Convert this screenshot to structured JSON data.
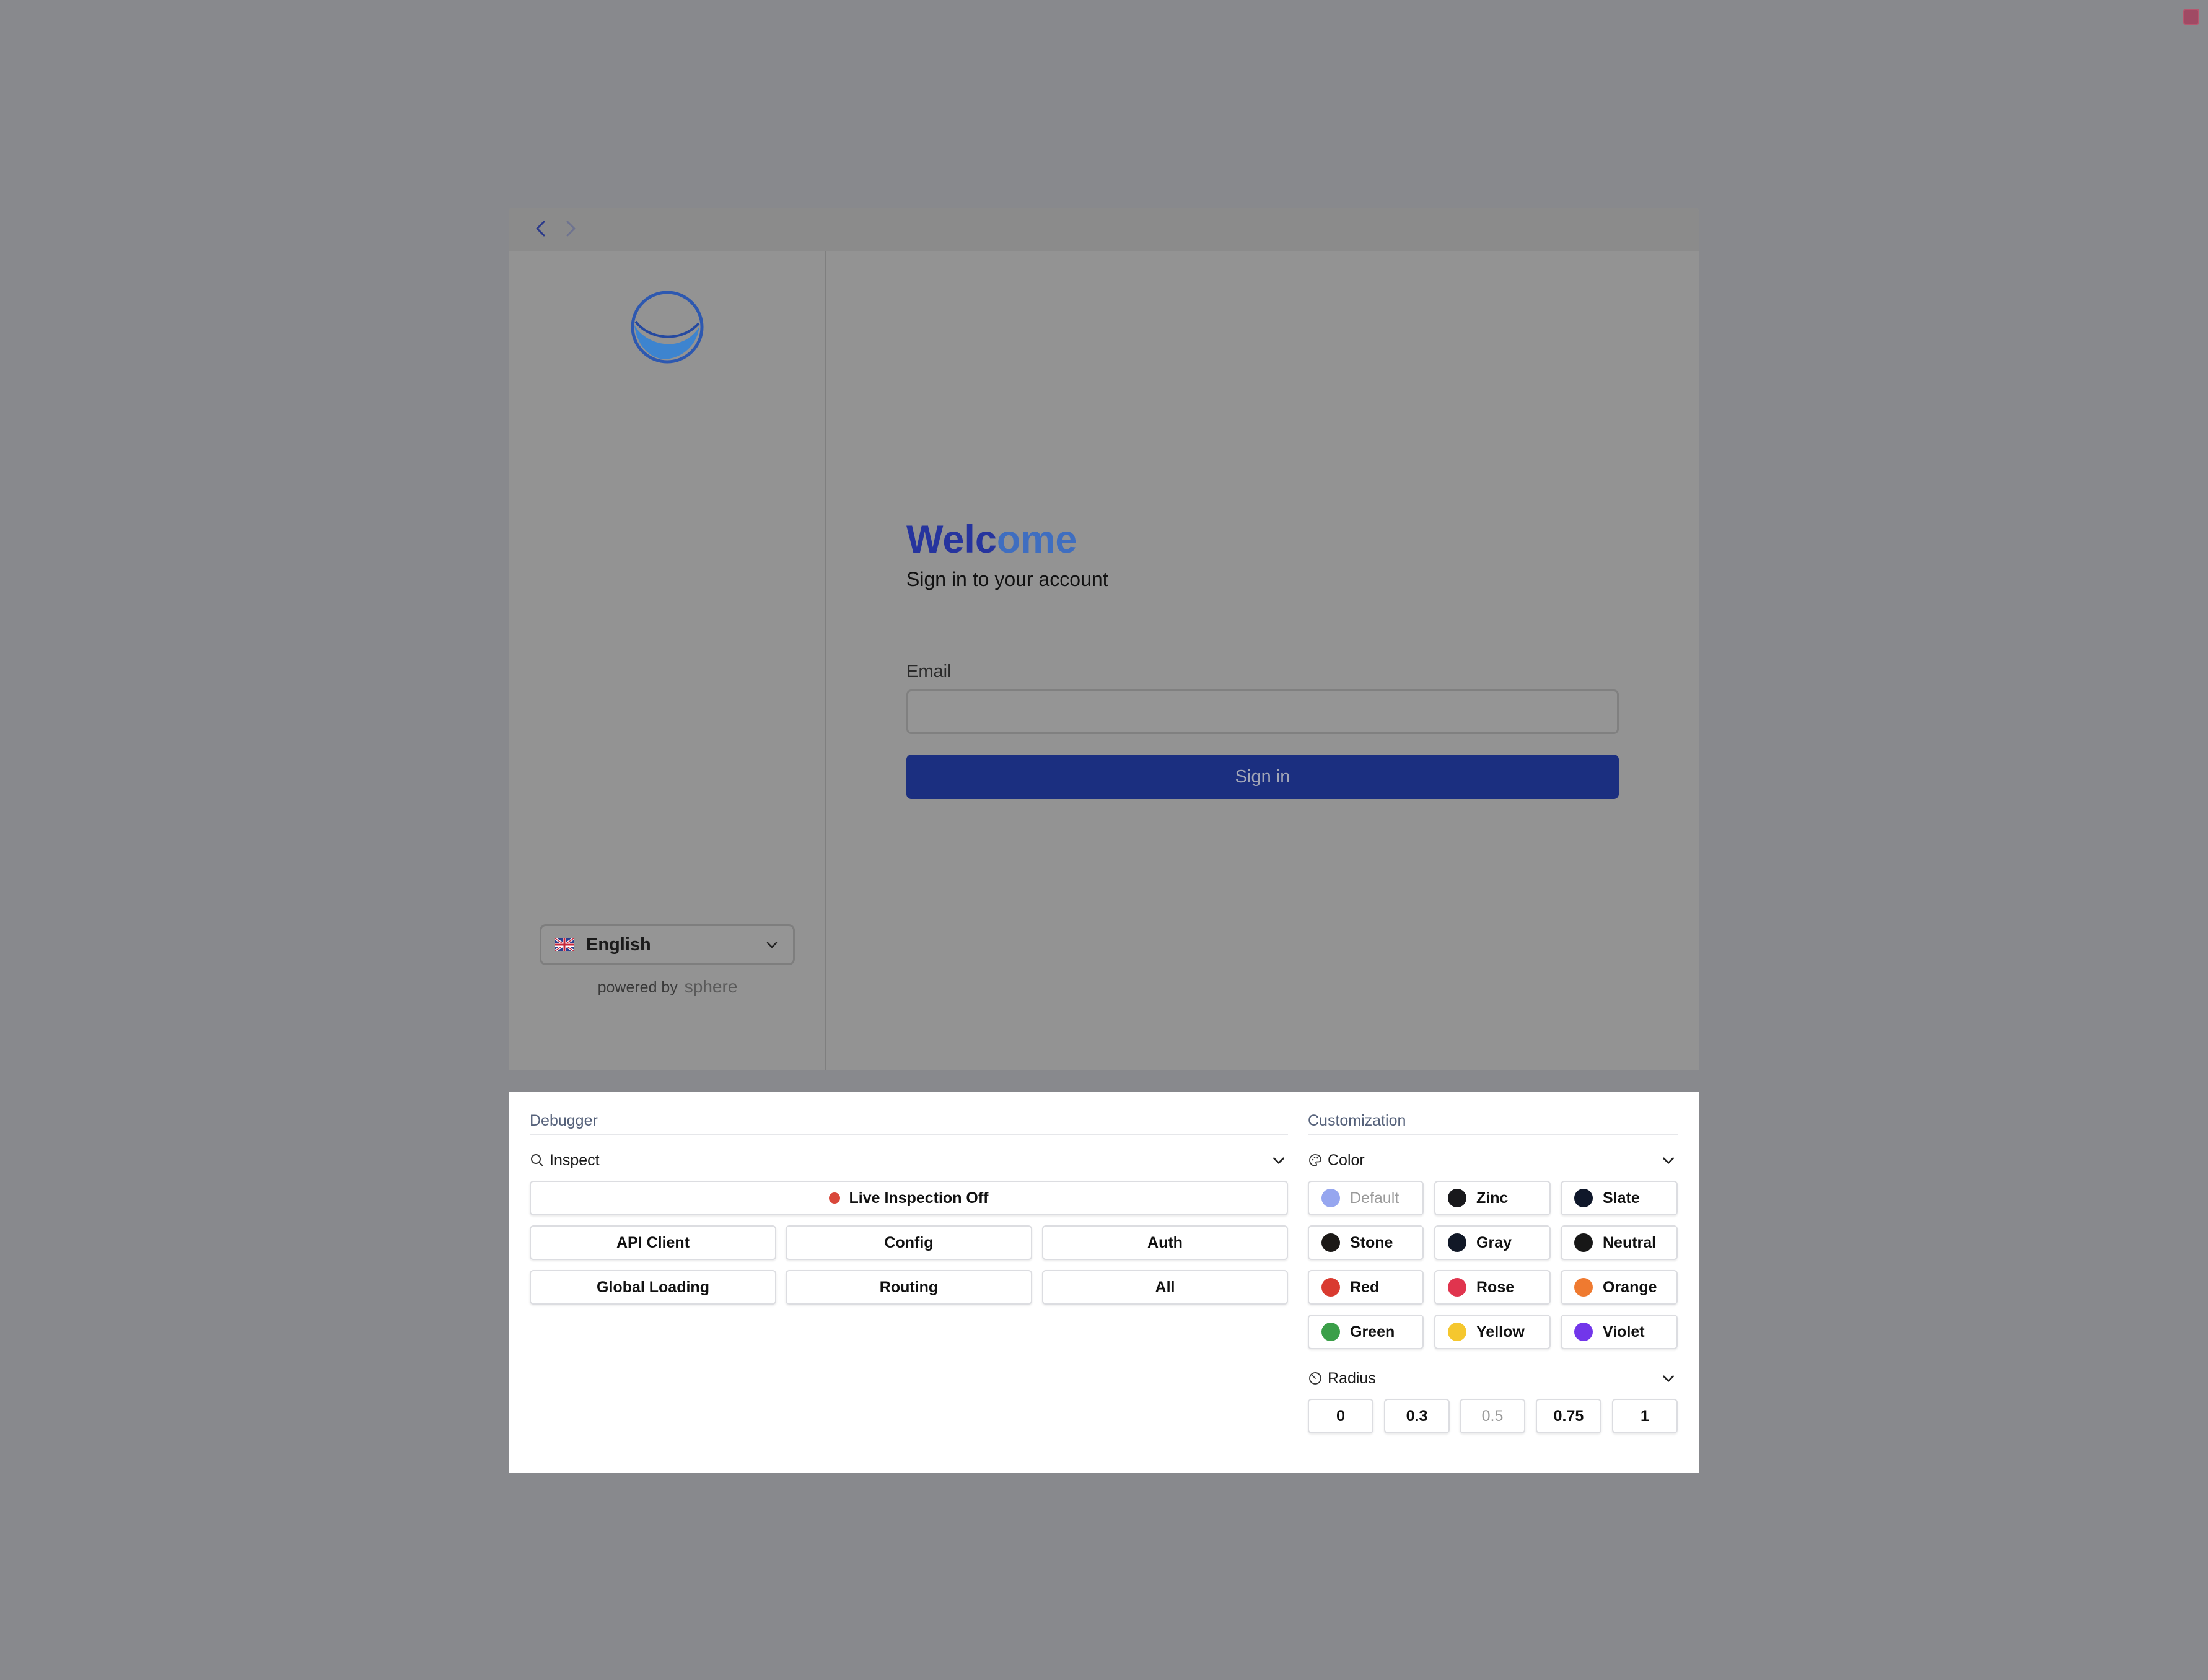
{
  "nav": {
    "back_label": "Back",
    "forward_label": "Forward"
  },
  "login": {
    "title_part1": "Welc",
    "title_part2": "ome",
    "subtitle": "Sign in to your account",
    "email_label": "Email",
    "email_value": "",
    "email_placeholder": "",
    "signin_label": "Sign in",
    "language": "English",
    "powered_by": "powered by",
    "brand": "sphere"
  },
  "debugger": {
    "title": "Debugger",
    "inspect_label": "Inspect",
    "live_label": "Live Inspection Off",
    "live_dot_color": "#d9483b",
    "buttons": [
      "API Client",
      "Config",
      "Auth",
      "Global Loading",
      "Routing",
      "All"
    ]
  },
  "customization": {
    "title": "Customization",
    "color_label": "Color",
    "colors": [
      {
        "label": "Default",
        "swatch": "#96a6ef"
      },
      {
        "label": "Zinc",
        "swatch": "#18181b"
      },
      {
        "label": "Slate",
        "swatch": "#0f172a"
      },
      {
        "label": "Stone",
        "swatch": "#1c1917"
      },
      {
        "label": "Gray",
        "swatch": "#111827"
      },
      {
        "label": "Neutral",
        "swatch": "#171717"
      },
      {
        "label": "Red",
        "swatch": "#d93a30"
      },
      {
        "label": "Rose",
        "swatch": "#e0344e"
      },
      {
        "label": "Orange",
        "swatch": "#ef7a30"
      },
      {
        "label": "Green",
        "swatch": "#3b9f49"
      },
      {
        "label": "Yellow",
        "swatch": "#f5c72e"
      },
      {
        "label": "Violet",
        "swatch": "#7236ea"
      }
    ],
    "radius_label": "Radius",
    "radius": [
      "0",
      "0.3",
      "0.5",
      "0.75",
      "1"
    ]
  },
  "colors": {
    "backdrop": "#88898d",
    "primary": "#1b2f80",
    "title_gradient_start": "#26349e",
    "title_gradient_end": "#3f6ec0"
  }
}
